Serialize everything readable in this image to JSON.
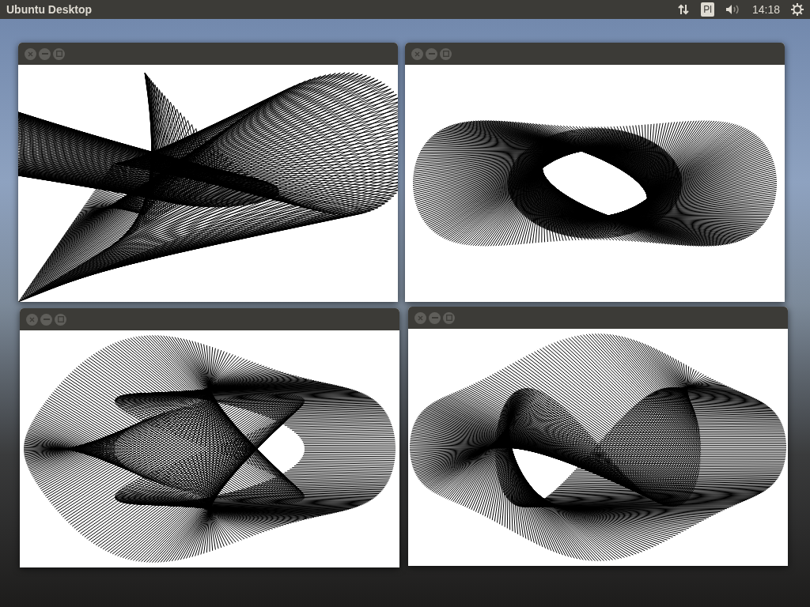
{
  "top_bar": {
    "title": "Ubuntu Desktop",
    "keyboard_layout": "Pl",
    "clock": "14:18"
  },
  "windows": [
    {
      "kind": "fan"
    },
    {
      "kind": "swirl"
    },
    {
      "kind": "loops"
    },
    {
      "kind": "rings"
    }
  ]
}
